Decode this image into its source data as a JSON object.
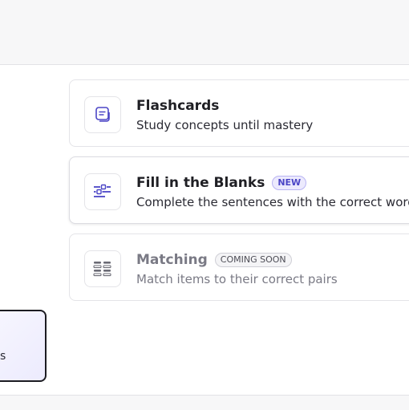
{
  "options": [
    {
      "title": "Flashcards",
      "description": "Study concepts until mastery",
      "icon": "flashcards-icon"
    },
    {
      "title": "Fill in the Blanks",
      "badge": "NEW",
      "description": "Complete the sentences with the correct words",
      "icon": "fill-blanks-icon"
    },
    {
      "title": "Matching",
      "badge": "COMING SOON",
      "description": "Match items to their correct pairs",
      "icon": "matching-icon"
    }
  ],
  "side_card": {
    "fragment": "s"
  },
  "colors": {
    "accent": "#4b45c6",
    "border": "#e4e4e8",
    "muted": "#7a7a85"
  }
}
